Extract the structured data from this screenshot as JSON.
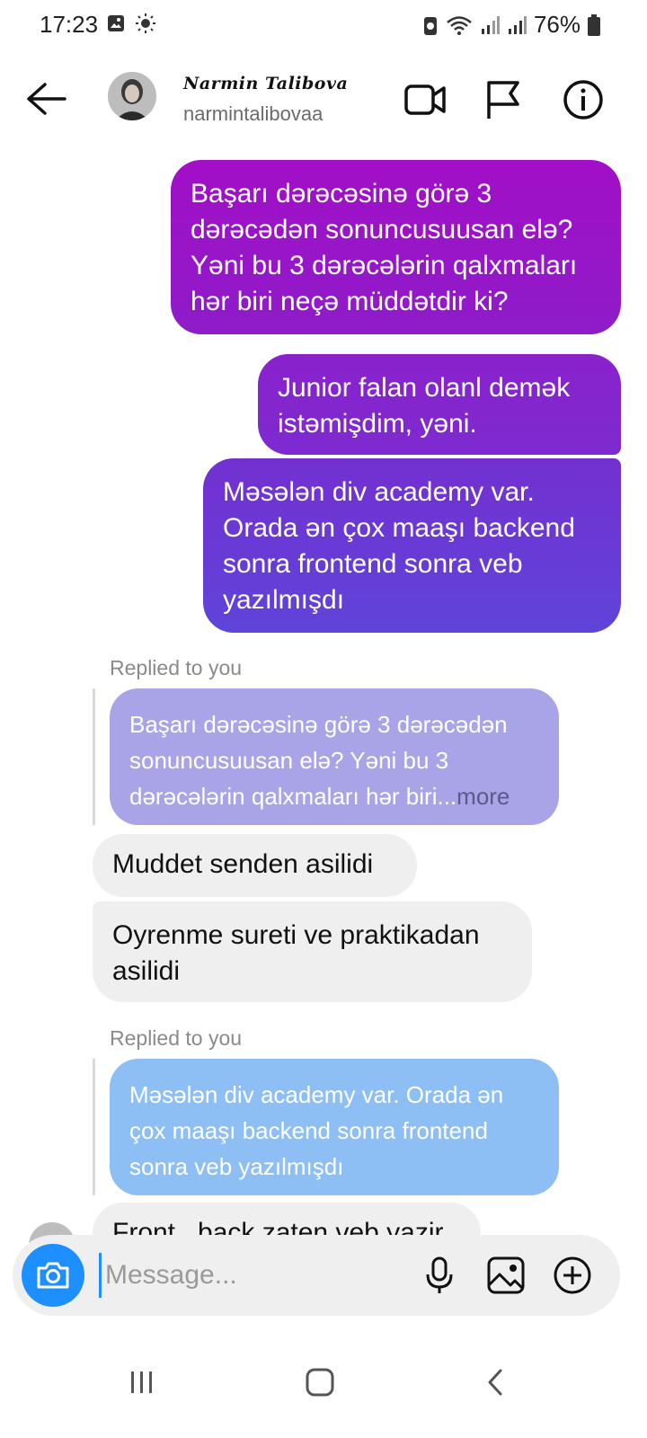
{
  "status_bar": {
    "time": "17:23",
    "battery_percent": "76%"
  },
  "header": {
    "contact_name": "Narmin Talibova",
    "username": "narmintalibovaa"
  },
  "messages": {
    "out1": "Başarı dərəcəsinə görə 3 dərəcədən sonuncusuusan elə? Yəni bu 3 dərəcələrin qalxmaları hər biri neçə müddətdir ki?",
    "out2": "Junior falan olanl demək istəmişdim, yəni.",
    "out3": "Məsələn div academy var. Orada ən çox maaşı backend sonra frontend sonra veb yazılmışdı",
    "reply1": {
      "label": "Replied to you",
      "quote": "Başarı dərəcəsinə görə 3 dərəcədən sonuncusuusan elə? Yəni bu 3 dərəcələrin qalxmaları hər biri...",
      "more": "more"
    },
    "in1": "Muddet senden asilidi",
    "in2": "Oyrenme sureti ve praktikadan asilidi",
    "reply2": {
      "label": "Replied to you",
      "quote": "Məsələn div academy var. Orada ən çox maaşı backend sonra frontend sonra veb yazılmışdı"
    },
    "in3_partial": "Front , back zaten veb yazir"
  },
  "composer": {
    "placeholder": "Message..."
  },
  "colors": {
    "bubble_gradient_top": "#a20fc6",
    "bubble_gradient_mid": "#7b2fd0",
    "bubble_gradient_bottom": "#5e45d8",
    "reply_quote_purple": "#a9a3e8",
    "reply_quote_blue": "#8dbff5",
    "camera_button": "#1e8fff"
  },
  "icons": {
    "back": "back-arrow-icon",
    "video": "video-call-icon",
    "flag": "flag-icon",
    "info": "info-icon",
    "camera": "camera-icon",
    "mic": "microphone-icon",
    "gallery": "gallery-icon",
    "plus": "plus-circle-icon"
  }
}
